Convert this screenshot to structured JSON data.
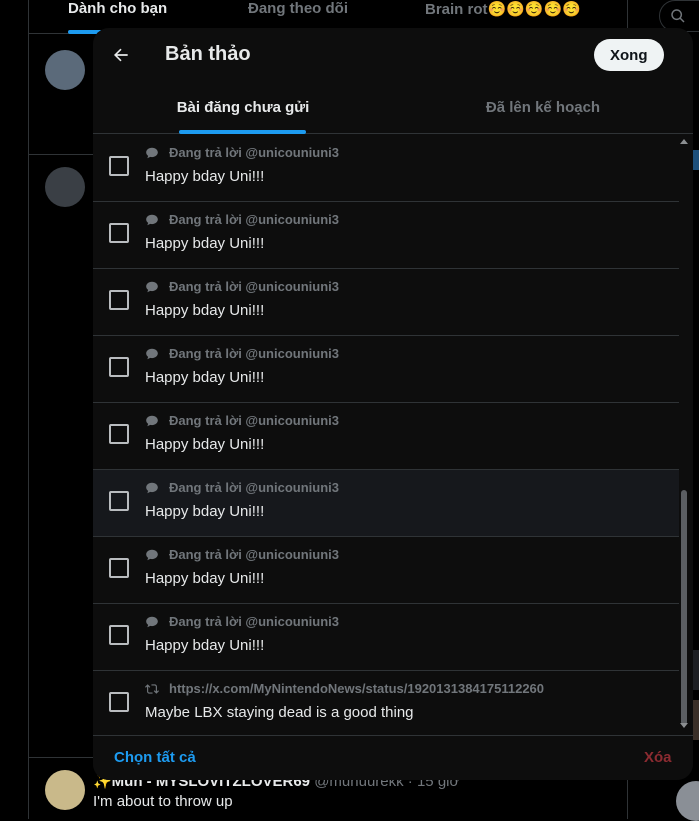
{
  "background": {
    "tabs": [
      "Dành cho bạn",
      "Đang theo dõi",
      "Brain rot☺️☺️☺️☺️☺️"
    ],
    "tweet": {
      "name": "✨Mun - MYSLOVITZLOVER69",
      "handle": "@munuurekk · 15 giờ",
      "text": "I'm about to throw up"
    }
  },
  "modal": {
    "back_icon": "arrow-left-icon",
    "title": "Bản thảo",
    "done_label": "Xong",
    "tabs": [
      {
        "label": "Bài đăng chưa gửi",
        "active": true
      },
      {
        "label": "Đã lên kế hoạch",
        "active": false
      }
    ],
    "drafts": [
      {
        "icon": "reply-bubble-icon",
        "meta": "Đang trả lời @unicouniuni3",
        "text": "Happy bday Uni!!!"
      },
      {
        "icon": "reply-bubble-icon",
        "meta": "Đang trả lời @unicouniuni3",
        "text": "Happy bday Uni!!!"
      },
      {
        "icon": "reply-bubble-icon",
        "meta": "Đang trả lời @unicouniuni3",
        "text": "Happy bday Uni!!!"
      },
      {
        "icon": "reply-bubble-icon",
        "meta": "Đang trả lời @unicouniuni3",
        "text": "Happy bday Uni!!!"
      },
      {
        "icon": "reply-bubble-icon",
        "meta": "Đang trả lời @unicouniuni3",
        "text": "Happy bday Uni!!!"
      },
      {
        "icon": "reply-bubble-icon",
        "meta": "Đang trả lời @unicouniuni3",
        "text": "Happy bday Uni!!!"
      },
      {
        "icon": "reply-bubble-icon",
        "meta": "Đang trả lời @unicouniuni3",
        "text": "Happy bday Uni!!!"
      },
      {
        "icon": "reply-bubble-icon",
        "meta": "Đang trả lời @unicouniuni3",
        "text": "Happy bday Uni!!!"
      },
      {
        "icon": "repost-icon",
        "meta": "https://x.com/MyNintendoNews/status/1920131384175112260",
        "text": "Maybe LBX staying dead is a good thing"
      }
    ],
    "select_all_label": "Chọn tất cả",
    "delete_label": "Xóa"
  },
  "colors": {
    "accent": "#1d9bf0",
    "delete": "#8c2b31",
    "done_bg": "#eff3f4"
  }
}
